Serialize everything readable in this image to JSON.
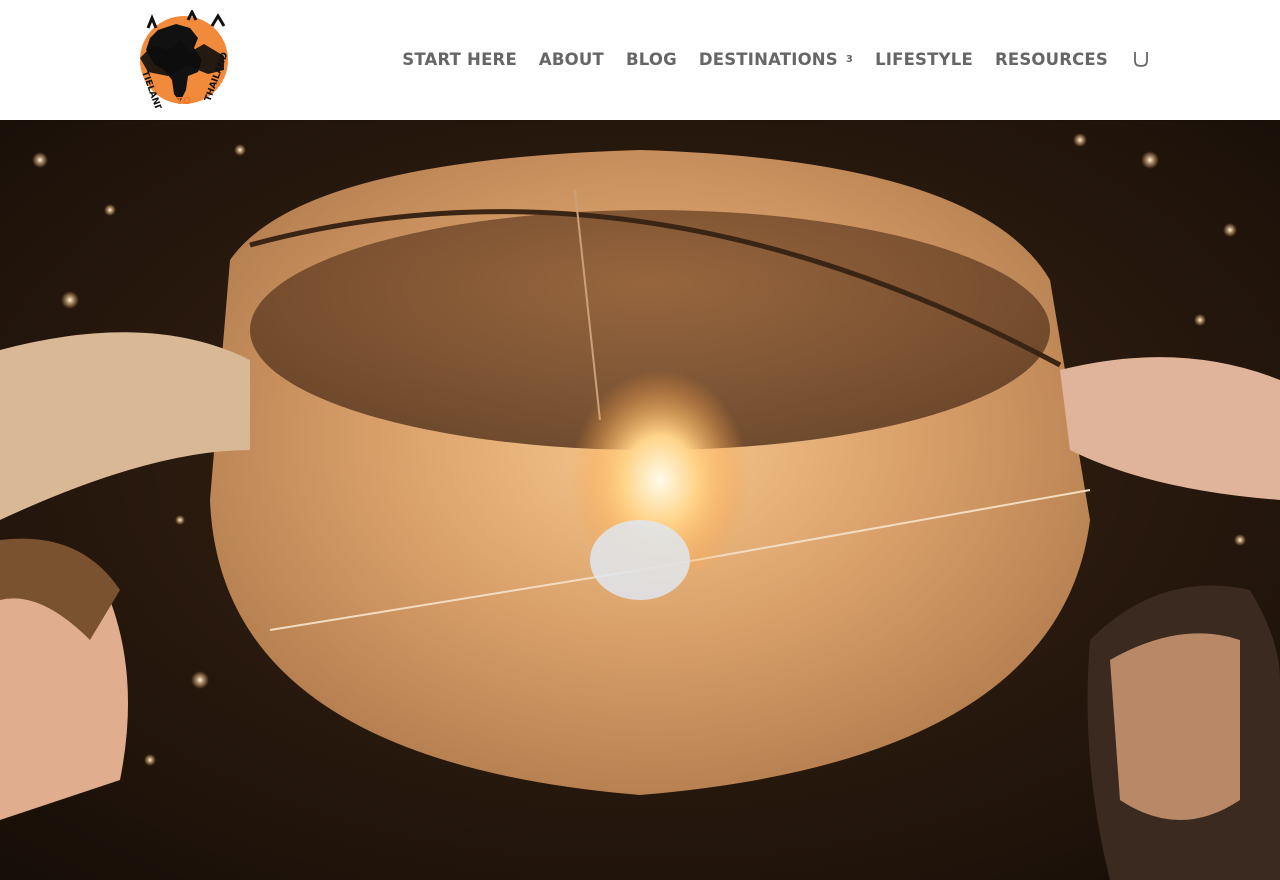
{
  "brand": {
    "logo_text_top": "TIELAND",
    "logo_text_mid": "TO",
    "logo_text_bottom": "THAILAND"
  },
  "nav": {
    "items": [
      {
        "label": "START HERE"
      },
      {
        "label": "ABOUT"
      },
      {
        "label": "BLOG"
      },
      {
        "label": "DESTINATIONS",
        "has_dropdown": true,
        "dropdown_glyph": "3"
      },
      {
        "label": "LIFESTYLE"
      },
      {
        "label": "RESOURCES"
      }
    ],
    "search_icon": "search-icon"
  },
  "hero": {
    "image": "sky-lantern-festival-photo",
    "accent": "#f0b064"
  },
  "colors": {
    "nav_text": "#666666",
    "header_bg": "#ffffff",
    "logo_orange": "#e8772e"
  }
}
